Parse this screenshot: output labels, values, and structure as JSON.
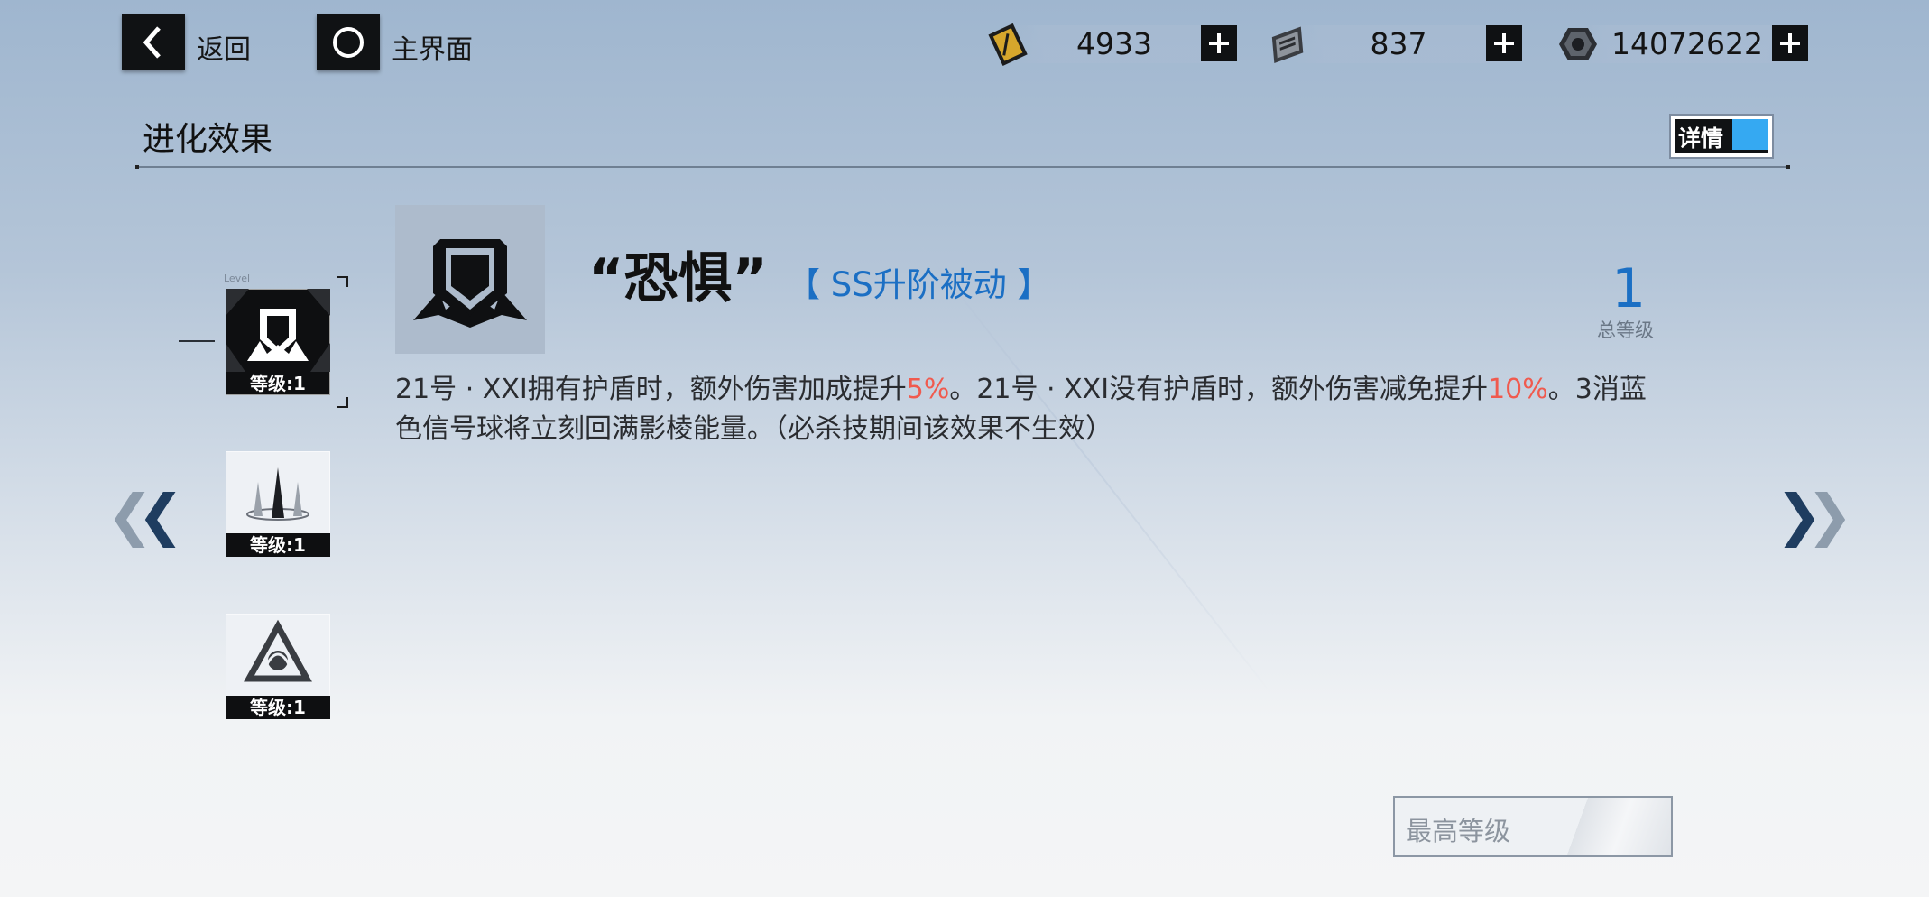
{
  "topbar": {
    "back_label": "返回",
    "home_label": "主界面",
    "resources": [
      {
        "icon": "gold-ticket-icon",
        "value": "4933"
      },
      {
        "icon": "chip-card-icon",
        "value": "837"
      },
      {
        "icon": "hex-nut-icon",
        "value": "14072622"
      }
    ]
  },
  "section": {
    "title": "进化效果",
    "detail_label": "详情"
  },
  "skills": [
    {
      "icon": "shield-skill-icon",
      "level_label": "等级:1",
      "active": true
    },
    {
      "icon": "spikes-skill-icon",
      "level_label": "等级:1",
      "active": false
    },
    {
      "icon": "triangle-skill-icon",
      "level_label": "等级:1",
      "active": false
    }
  ],
  "level_tag": "Level",
  "main": {
    "name": "“恐惧”",
    "tag": "【 SS升阶被动 】",
    "total_level": "1",
    "total_level_label": "总等级",
    "desc": {
      "p1": "21号 · XXI拥有护盾时，额外伤害加成提升",
      "v1": "5%",
      "p2": "。21号 · XXI没有护盾时，额外伤害减免提升",
      "v2": "10%",
      "p3": "。3消蓝色信号球将立刻回满影棱能量。（必杀技期间该效果不生效）"
    },
    "max_label": "最高等级"
  },
  "colors": {
    "accent_blue": "#1b6fc4",
    "highlight_red": "#f05a4e",
    "toggle_blue": "#35a9f2"
  }
}
